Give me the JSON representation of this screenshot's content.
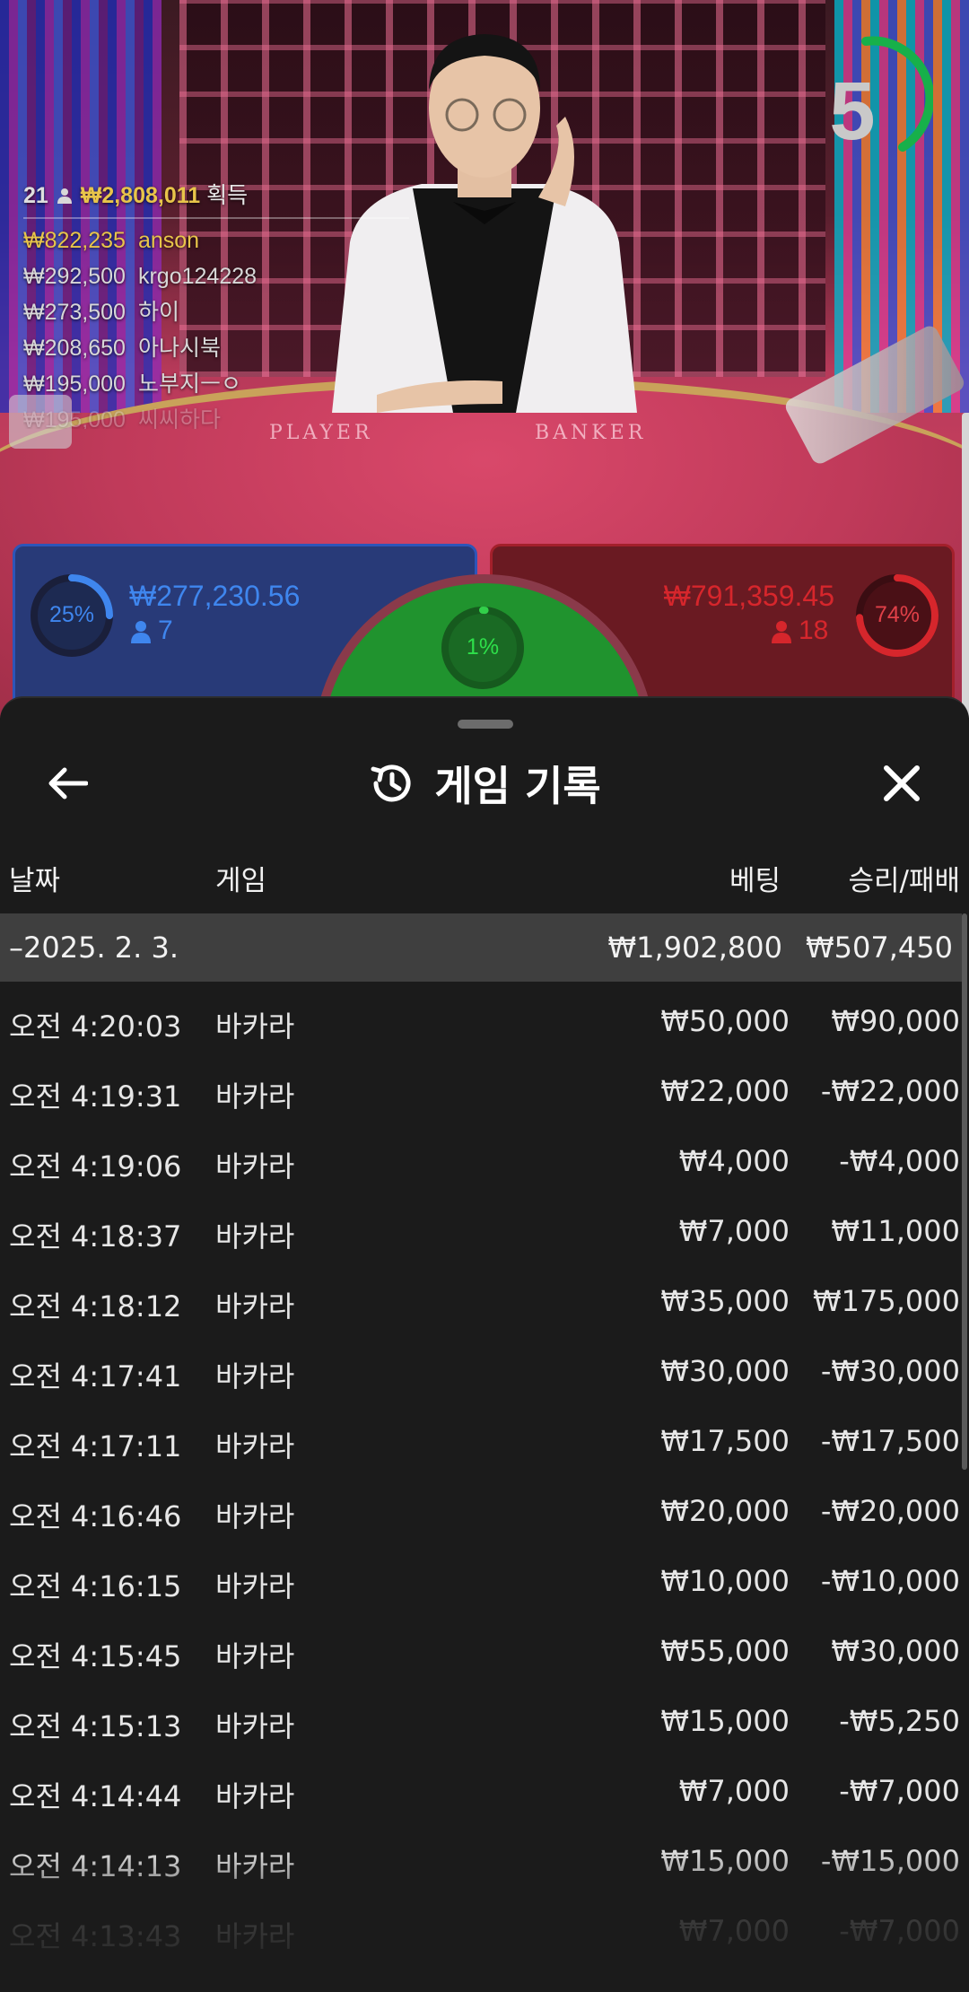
{
  "countdown": {
    "value": "5"
  },
  "table_labels": {
    "player": "PLAYER",
    "banker": "BANKER"
  },
  "winners": {
    "count": "21",
    "total": "₩2,808,011",
    "label": "획득",
    "list": [
      {
        "amount": "₩822,235",
        "name": "anson"
      },
      {
        "amount": "₩292,500",
        "name": "krgo124228"
      },
      {
        "amount": "₩273,500",
        "name": "하이"
      },
      {
        "amount": "₩208,650",
        "name": "아나시북"
      },
      {
        "amount": "₩195,000",
        "name": "노부지ㅡㅇ"
      },
      {
        "amount": "₩195,000",
        "name": "씨씨하다"
      }
    ]
  },
  "bets": {
    "player": {
      "percent": "25%",
      "amount": "₩277,230.56",
      "players": "7",
      "ratio": 0.25
    },
    "tie": {
      "percent": "1%",
      "ratio": 0.01
    },
    "banker": {
      "percent": "74%",
      "amount": "₩791,359.45",
      "players": "18",
      "ratio": 0.74
    }
  },
  "colors": {
    "player": "#3f86ee",
    "banker": "#d6262c",
    "tie": "#20932e",
    "gold": "#e8c54a",
    "sheet_bg": "#1b1b1b"
  },
  "sheet": {
    "title": "게임 기록",
    "icons": {
      "back": "arrow-left-icon",
      "history": "history-icon",
      "close": "close-icon"
    },
    "columns": {
      "date": "날짜",
      "game": "게임",
      "bet": "베팅",
      "winloss": "승리/패배"
    },
    "summary": {
      "date": "–2025. 2. 3.",
      "bet": "₩1,902,800",
      "winloss": "₩507,450"
    },
    "rows": [
      {
        "time": "오전 4:20:03",
        "game": "바카라",
        "bet": "₩50,000",
        "winloss": "₩90,000"
      },
      {
        "time": "오전 4:19:31",
        "game": "바카라",
        "bet": "₩22,000",
        "winloss": "-₩22,000"
      },
      {
        "time": "오전 4:19:06",
        "game": "바카라",
        "bet": "₩4,000",
        "winloss": "-₩4,000"
      },
      {
        "time": "오전 4:18:37",
        "game": "바카라",
        "bet": "₩7,000",
        "winloss": "₩11,000"
      },
      {
        "time": "오전 4:18:12",
        "game": "바카라",
        "bet": "₩35,000",
        "winloss": "₩175,000"
      },
      {
        "time": "오전 4:17:41",
        "game": "바카라",
        "bet": "₩30,000",
        "winloss": "-₩30,000"
      },
      {
        "time": "오전 4:17:11",
        "game": "바카라",
        "bet": "₩17,500",
        "winloss": "-₩17,500"
      },
      {
        "time": "오전 4:16:46",
        "game": "바카라",
        "bet": "₩20,000",
        "winloss": "-₩20,000"
      },
      {
        "time": "오전 4:16:15",
        "game": "바카라",
        "bet": "₩10,000",
        "winloss": "-₩10,000"
      },
      {
        "time": "오전 4:15:45",
        "game": "바카라",
        "bet": "₩55,000",
        "winloss": "₩30,000"
      },
      {
        "time": "오전 4:15:13",
        "game": "바카라",
        "bet": "₩15,000",
        "winloss": "-₩5,250"
      },
      {
        "time": "오전 4:14:44",
        "game": "바카라",
        "bet": "₩7,000",
        "winloss": "-₩7,000"
      },
      {
        "time": "오전 4:14:13",
        "game": "바카라",
        "bet": "₩15,000",
        "winloss": "-₩15,000"
      },
      {
        "time": "오전 4:13:43",
        "game": "바카라",
        "bet": "₩7,000",
        "winloss": "-₩7,000"
      }
    ]
  }
}
